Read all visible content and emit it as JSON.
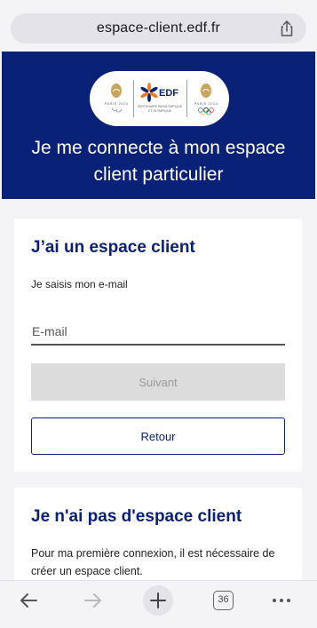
{
  "browser": {
    "url": "espace-client.edf.fr",
    "tab_count": "36"
  },
  "hero": {
    "title": "Je me connecte à mon espace client particulier",
    "logos": {
      "left_caption": "PARIS 2024",
      "center_word": "EDF",
      "center_caption": "PARTENAIRE PARALYMPIQUE ET OLYMPIQUE",
      "right_caption": "PARIS 2024"
    },
    "background_color": "#0a2178"
  },
  "login_card": {
    "title": "J’ai un espace client",
    "intro": "Je saisis mon e-mail",
    "email_placeholder": "E-mail",
    "next_label": "Suivant",
    "back_label": "Retour"
  },
  "signup_card": {
    "title": "Je n'ai pas d'espace client",
    "text": "Pour ma première connexion, il est nécessaire de créer un espace client."
  },
  "icons": {
    "share": "share-icon",
    "back": "arrow-left-icon",
    "forward": "arrow-right-icon",
    "new_tab": "plus-icon",
    "tabs": "tabs-icon",
    "more": "more-icon"
  }
}
